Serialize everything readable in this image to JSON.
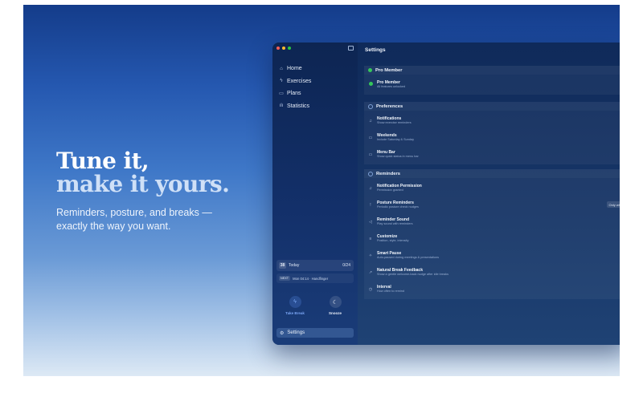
{
  "hero": {
    "title_line1": "Tune it,",
    "title_line2": "make it yours.",
    "subtitle": "Reminders, posture, and breaks — exactly the way you want."
  },
  "window": {
    "traffic_light_colors": [
      "#ff5f57",
      "#febc2e",
      "#28c840"
    ],
    "title": "Settings"
  },
  "sidebar": {
    "items": [
      {
        "label": "Home",
        "icon": "home-icon",
        "glyph": "⌂"
      },
      {
        "label": "Exercises",
        "icon": "bolt-icon",
        "glyph": "ϟ"
      },
      {
        "label": "Plans",
        "icon": "calendar-icon",
        "glyph": "▭"
      },
      {
        "label": "Statistics",
        "icon": "chart-icon",
        "glyph": "ılı"
      }
    ],
    "today": {
      "day": "38",
      "label": "Today",
      "count": "0/24"
    },
    "next": {
      "tag": "NEXT",
      "text": "Mon 04:14 · Handfinger"
    },
    "actions": {
      "take_break": {
        "label": "Take Break",
        "icon": "bolt-icon",
        "glyph": "ϟ"
      },
      "snooze": {
        "label": "Snooze",
        "icon": "moon-icon",
        "glyph": "☾"
      }
    },
    "settings": {
      "label": "Settings",
      "icon": "gear-icon",
      "glyph": "⚙"
    }
  },
  "sections": {
    "pro": {
      "title": "Pro Member",
      "rows": [
        {
          "title": "Pro Member",
          "subtitle": "All features unlocked"
        }
      ]
    },
    "preferences": {
      "title": "Preferences",
      "rows": [
        {
          "title": "Notifications",
          "subtitle": "Show exercise reminders",
          "icon": "bell-icon",
          "glyph": "♫"
        },
        {
          "title": "Weekends",
          "subtitle": "Include Saturday & Sunday",
          "icon": "calendar-icon",
          "glyph": "▭"
        },
        {
          "title": "Menu Bar",
          "subtitle": "Show quick status in menu bar",
          "icon": "menubar-icon",
          "glyph": "▭"
        }
      ]
    },
    "reminders": {
      "title": "Reminders",
      "rows": [
        {
          "title": "Notification Permission",
          "subtitle": "Permission granted",
          "icon": "bell-icon",
          "glyph": "♫"
        },
        {
          "title": "Posture Reminders",
          "subtitle": "Periodic posture check nudges",
          "icon": "posture-icon",
          "glyph": "ǃ",
          "pill": "Only while"
        },
        {
          "title": "Reminder Sound",
          "subtitle": "Play sound with reminders",
          "icon": "speaker-icon",
          "glyph": "◁"
        },
        {
          "title": "Customize",
          "subtitle": "Position, style, intensity",
          "icon": "sliders-icon",
          "glyph": "≡"
        },
        {
          "title": "Smart Pause",
          "subtitle": "Auto-paused during meetings & presentations",
          "icon": "pause-icon",
          "glyph": "✧"
        },
        {
          "title": "Natural Break Feedback",
          "subtitle": "Show a gentle welcome-back nudge after idle breaks",
          "icon": "feedback-icon",
          "glyph": "↗"
        },
        {
          "title": "Interval",
          "subtitle": "How often to remind",
          "icon": "clock-icon",
          "glyph": "◷"
        }
      ]
    }
  },
  "colors": {
    "accent": "#35c75a",
    "take_break": "#5b8ef0"
  }
}
